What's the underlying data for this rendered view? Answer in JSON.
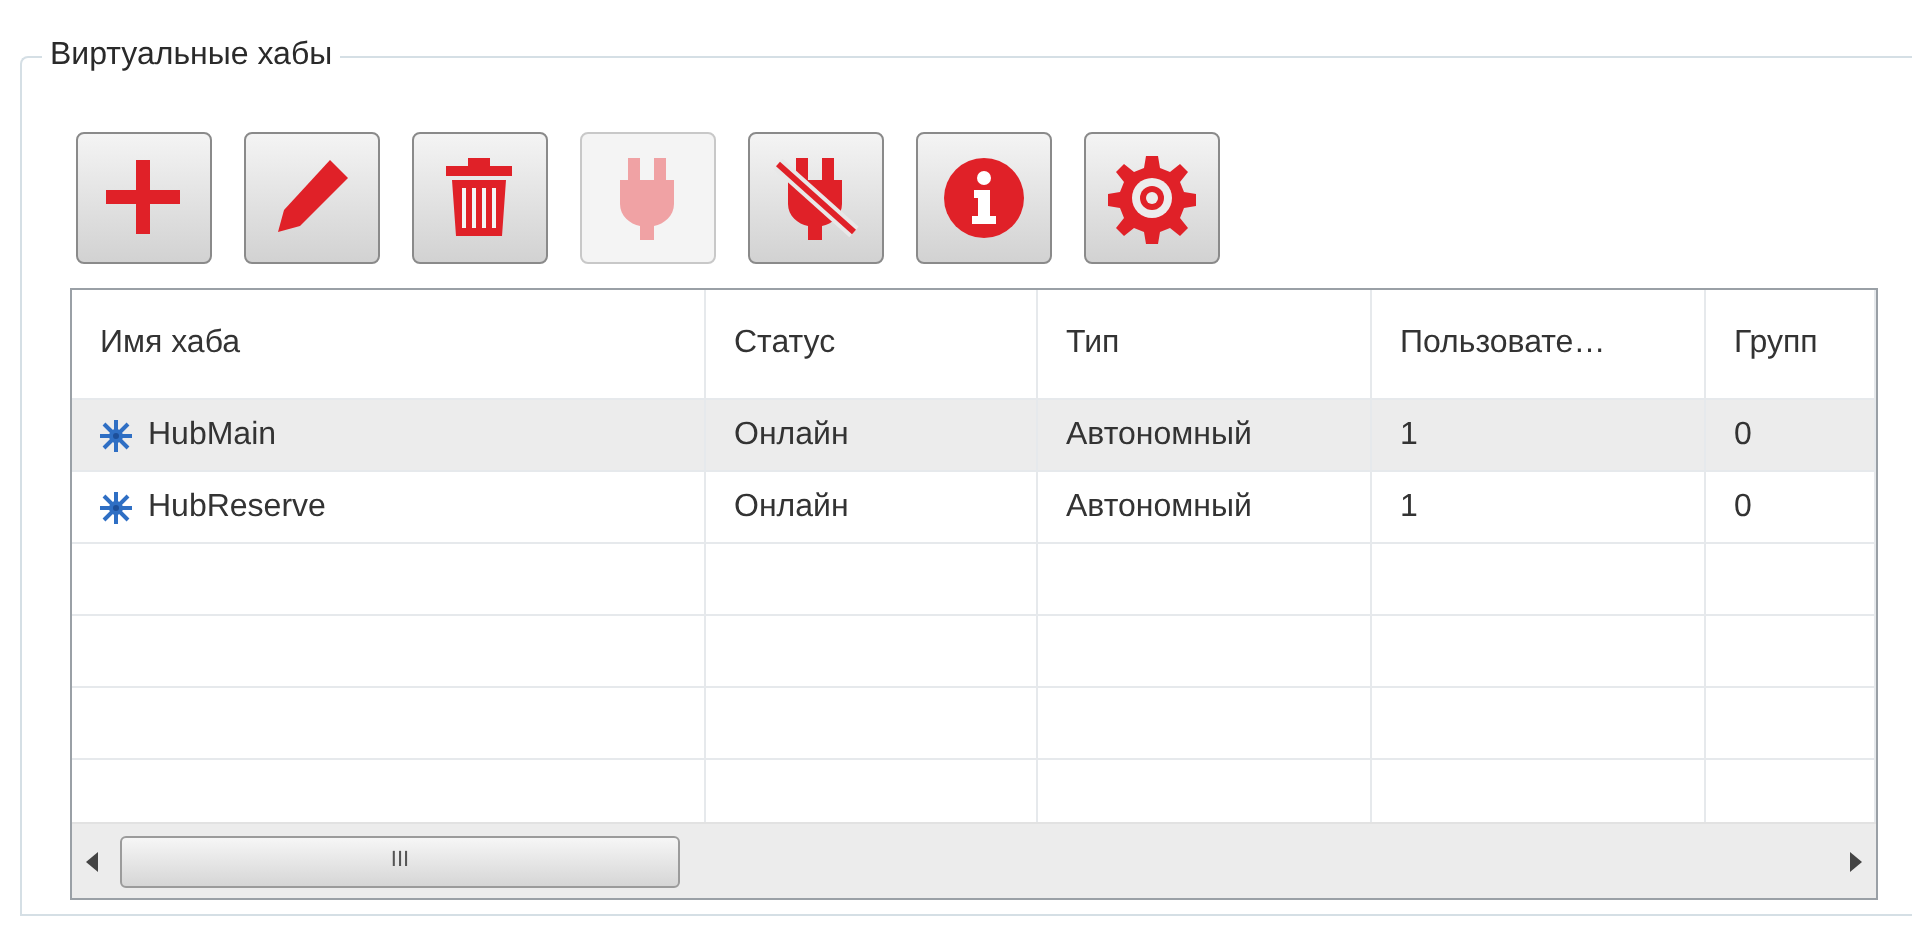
{
  "group_title": "Виртуальные хабы",
  "toolbar": [
    {
      "disabled": false
    },
    {
      "disabled": false
    },
    {
      "disabled": false
    },
    {
      "disabled": true
    },
    {
      "disabled": false
    },
    {
      "disabled": false
    },
    {
      "disabled": false
    }
  ],
  "table": {
    "columns": [
      "Имя хаба",
      "Статус",
      "Тип",
      "Пользовате…",
      "Групп"
    ],
    "rows": [
      {
        "cells": [
          "HubMain",
          "Онлайн",
          "Автономный",
          "1",
          "0"
        ],
        "selected": true
      },
      {
        "cells": [
          "HubReserve",
          "Онлайн",
          "Автономный",
          "1",
          "0"
        ],
        "selected": false
      }
    ],
    "scroll_thumb_char": "III"
  }
}
